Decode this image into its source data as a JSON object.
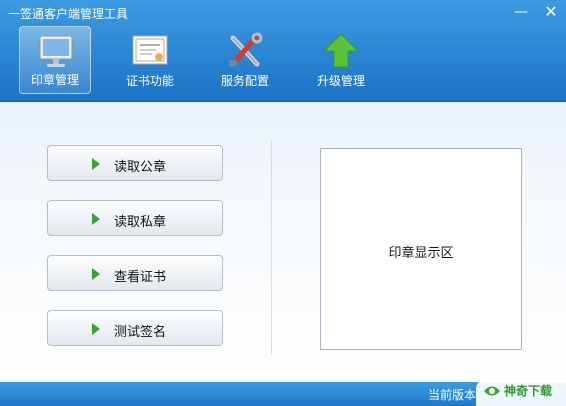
{
  "window": {
    "title": "一签通客户端管理工具",
    "minimize_glyph": "—",
    "close_glyph": "✕"
  },
  "toolbar": {
    "items": [
      {
        "label": "印章管理",
        "icon": "monitor-icon",
        "active": true
      },
      {
        "label": "证书功能",
        "icon": "certificate-icon",
        "active": false
      },
      {
        "label": "服务配置",
        "icon": "tools-icon",
        "active": false
      },
      {
        "label": "升级管理",
        "icon": "upgrade-arrow-icon",
        "active": false
      }
    ]
  },
  "actions": [
    {
      "label": "读取公章"
    },
    {
      "label": "读取私章"
    },
    {
      "label": "查看证书"
    },
    {
      "label": "测试签名"
    }
  ],
  "preview": {
    "label": "印章显示区"
  },
  "footer": {
    "version_label": "当前版本"
  },
  "watermark": {
    "text": "神奇下载"
  },
  "colors": {
    "header": "#2f8bd6",
    "accent_green": "#3aa335",
    "upgrade_green": "#5cc23a"
  }
}
